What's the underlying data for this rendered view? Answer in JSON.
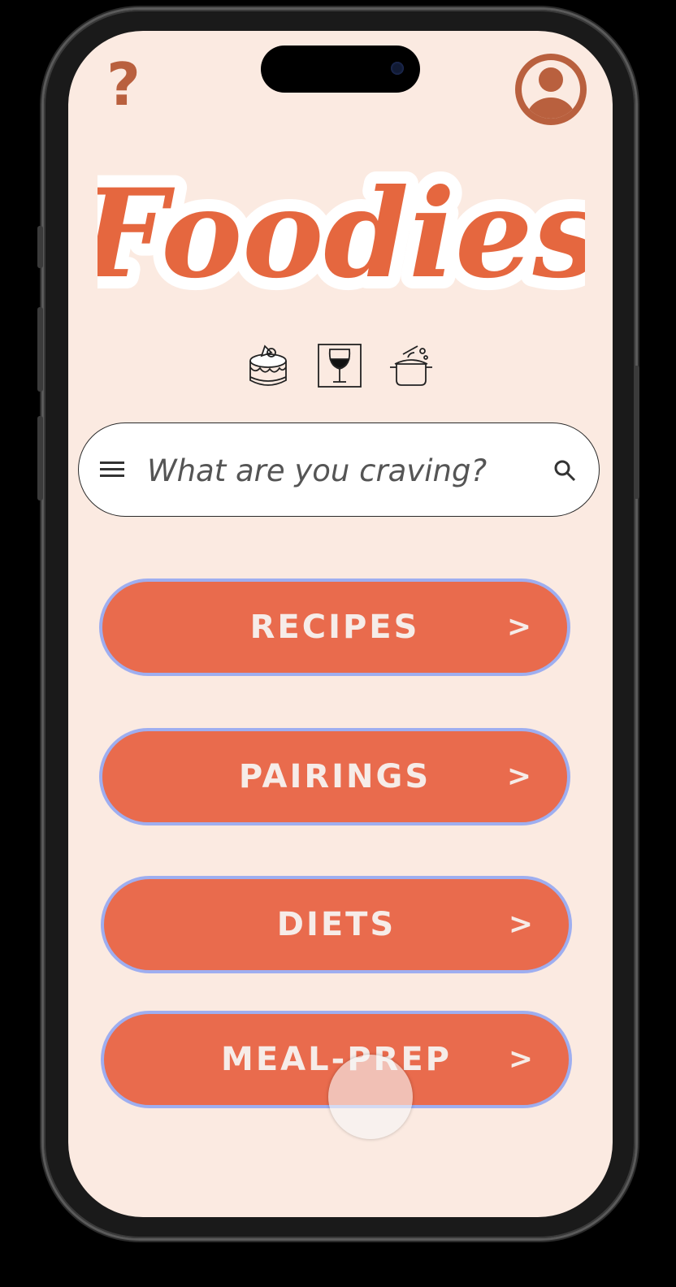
{
  "app": {
    "logo_text": "Foodies"
  },
  "header": {
    "help_icon_glyph": "?",
    "help_icon": "question-mark-icon",
    "profile_icon": "user-avatar-icon"
  },
  "categories": [
    {
      "icon": "cake-icon"
    },
    {
      "icon": "wine-glass-icon"
    },
    {
      "icon": "cooking-pot-icon"
    }
  ],
  "search": {
    "placeholder": "What are you craving?",
    "menu_icon": "hamburger-menu-icon",
    "search_icon": "search-icon"
  },
  "nav_buttons": [
    {
      "label": "RECIPES",
      "arrow": ">"
    },
    {
      "label": "PAIRINGS",
      "arrow": ">"
    },
    {
      "label": "DIETS",
      "arrow": ">"
    },
    {
      "label": "MEAL-PREP",
      "arrow": ">"
    }
  ],
  "colors": {
    "background": "#fbeae1",
    "accent": "#e96b4d",
    "accent_dark": "#b9603e",
    "button_border": "#9eaef0",
    "button_text": "#f6ece8"
  }
}
